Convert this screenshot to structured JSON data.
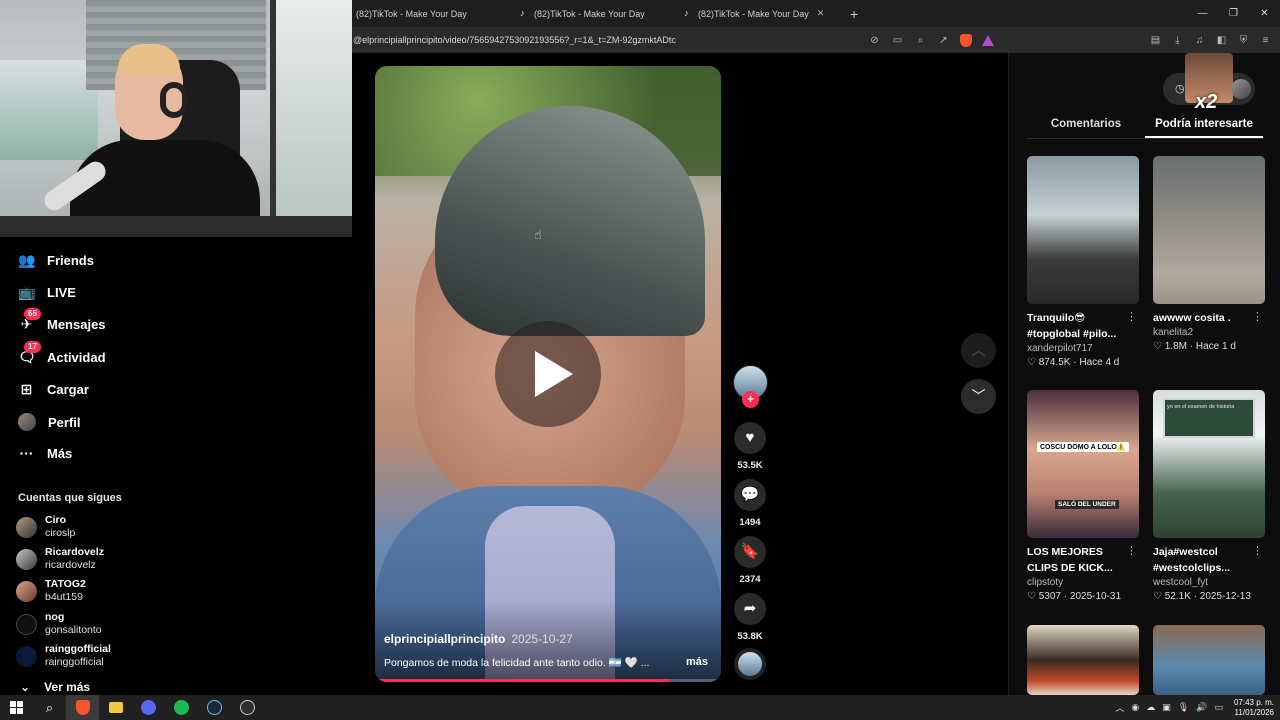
{
  "browser": {
    "tabs": [
      {
        "title": "(82)TikTok - Make Your Day"
      },
      {
        "title": "(82)TikTok - Make Your Day"
      },
      {
        "title": "(82)TikTok - Make Your Day"
      }
    ],
    "url": "@elprincipiallprincipito/video/7565942753092193556?_r=1&_t=ZM-92gzmktADtc"
  },
  "nav": {
    "items": [
      {
        "label": "Friends",
        "icon": "friends-icon"
      },
      {
        "label": "LIVE",
        "icon": "live-icon"
      },
      {
        "label": "Mensajes",
        "icon": "messages-icon",
        "badge": "65"
      },
      {
        "label": "Actividad",
        "icon": "activity-icon",
        "badge": "17"
      },
      {
        "label": "Cargar",
        "icon": "upload-icon"
      },
      {
        "label": "Perfil",
        "icon": "profile-avatar"
      },
      {
        "label": "Más",
        "icon": "more-icon"
      }
    ],
    "following_title": "Cuentas que sigues",
    "following": [
      {
        "name": "Ciro",
        "user": "ciroslp"
      },
      {
        "name": "Ricardovelz",
        "user": "ricardovelz"
      },
      {
        "name": "TATOG2",
        "user": "b4ut159"
      },
      {
        "name": "nog",
        "user": "gonsalitonto"
      },
      {
        "name": "rainggofficial",
        "user": "rainggofficial"
      }
    ],
    "see_more": "Ver más"
  },
  "video": {
    "author": "elprincipiallprincipito",
    "date": "2025-10-27",
    "description": "Pongamos de moda la felicidad ante tanto odio. 🇦🇷 🤍 ...",
    "more": "más",
    "progress": 0.85
  },
  "actions": {
    "likes": "53.5K",
    "comments": "1494",
    "saves": "2374",
    "shares": "53.8K"
  },
  "panel": {
    "tabs": [
      "Comentarios",
      "Podría interesarte"
    ],
    "overlay_label": "x2",
    "cards": [
      {
        "title": "Tranquilo😎 #topglobal #pilo...",
        "user": "xanderpilot717",
        "likes": "874.5K",
        "when": "Hace 4 d"
      },
      {
        "title": "awwww cosita .",
        "user": "kanelita2",
        "likes": "1.8M",
        "when": "Hace 1 d"
      },
      {
        "title": "LOS MEJORES CLIPS DE KICK...",
        "user": "clipstoty",
        "likes": "5307",
        "when": "2025-10-31",
        "thumb_label": "COSCU DOMO A LOLO⚠️",
        "thumb_label2": "SALÓ DEL UNDER"
      },
      {
        "title": "Jaja#westcol #westcolclips...",
        "user": "westcool_fyt",
        "likes": "52.1K",
        "when": "2025-12-13",
        "thumb_label": "yo en el examen de historia"
      },
      {
        "title": "",
        "user": "",
        "likes": "",
        "when": ""
      },
      {
        "title": "",
        "user": "",
        "likes": "",
        "when": ""
      }
    ]
  },
  "taskbar": {
    "time": "07:43 p. m.",
    "date": "11/01/2026"
  }
}
